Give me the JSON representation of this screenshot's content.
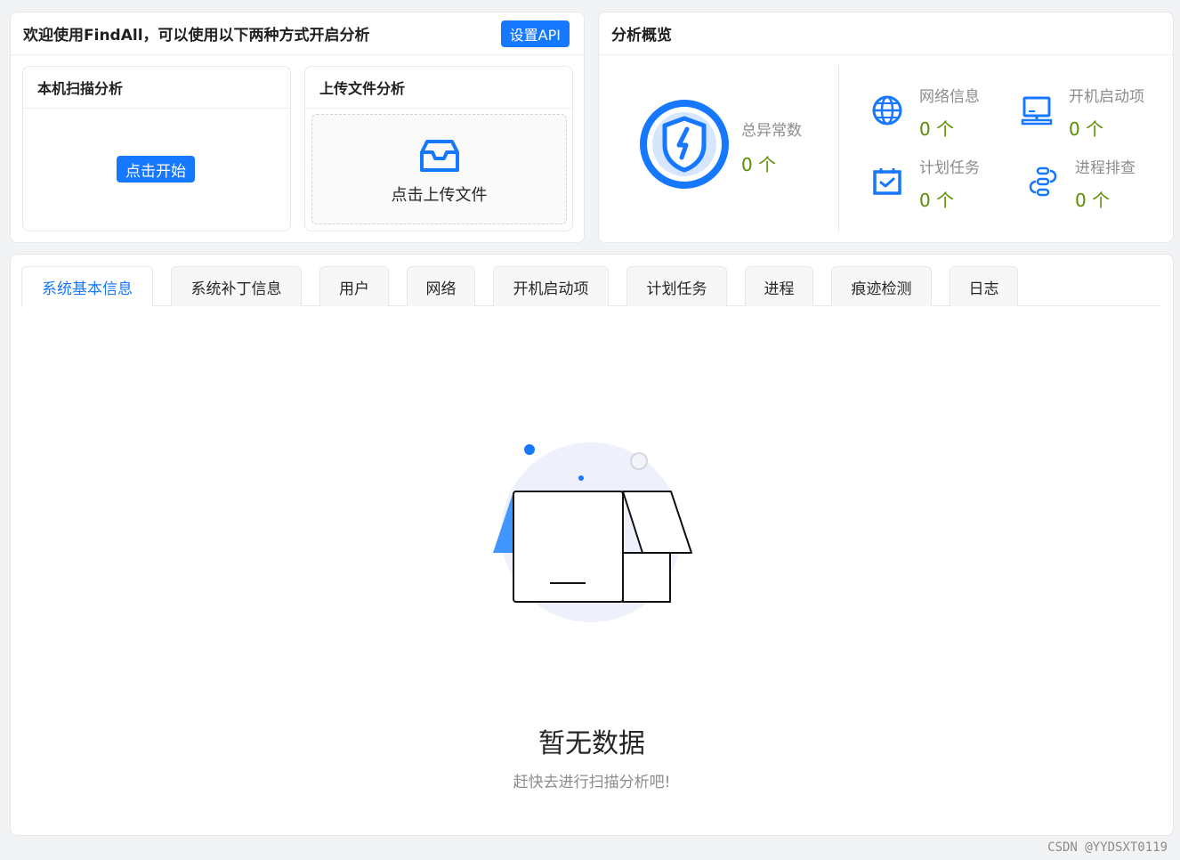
{
  "welcome": {
    "title": "欢迎使用FindAll，可以使用以下两种方式开启分析",
    "api_button": "设置API",
    "scan": {
      "title": "本机扫描分析",
      "button": "点击开始"
    },
    "upload": {
      "title": "上传文件分析",
      "text": "点击上传文件"
    }
  },
  "overview": {
    "title": "分析概览",
    "total": {
      "label": "总异常数",
      "value": "0 个"
    },
    "stats": [
      {
        "label": "网络信息",
        "value": "0 个",
        "icon": "globe-icon"
      },
      {
        "label": "开机启动项",
        "value": "0 个",
        "icon": "monitor-icon"
      },
      {
        "label": "计划任务",
        "value": "0 个",
        "icon": "calendar-check-icon"
      },
      {
        "label": "进程排查",
        "value": "0 个",
        "icon": "process-flow-icon"
      }
    ]
  },
  "tabs": [
    {
      "label": "系统基本信息",
      "active": true
    },
    {
      "label": "系统补丁信息"
    },
    {
      "label": "用户"
    },
    {
      "label": "网络"
    },
    {
      "label": "开机启动项"
    },
    {
      "label": "计划任务"
    },
    {
      "label": "进程"
    },
    {
      "label": "痕迹检测"
    },
    {
      "label": "日志"
    }
  ],
  "empty": {
    "title": "暂无数据",
    "subtitle": "赶快去进行扫描分析吧!"
  },
  "watermark": "CSDN @YYDSXT0119",
  "colors": {
    "accent": "#1677ff",
    "value_green": "#5b8c00"
  }
}
